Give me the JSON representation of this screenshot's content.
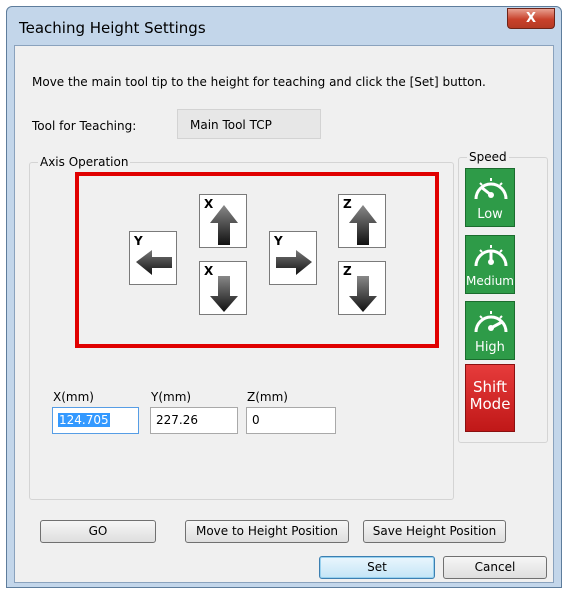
{
  "window": {
    "title": "Teaching Height Settings",
    "close_symbol": "X"
  },
  "instruction": "Move the main tool tip to the height for teaching and click the [Set] button.",
  "tool": {
    "label": "Tool for Teaching:",
    "value": "Main Tool TCP"
  },
  "axis_group": {
    "label": "Axis Operation",
    "jog_buttons": [
      {
        "axis": "Y",
        "direction": "minus",
        "icon": "arrow-left-icon"
      },
      {
        "axis": "X",
        "direction": "plus",
        "icon": "arrow-up-icon"
      },
      {
        "axis": "X",
        "direction": "minus",
        "icon": "arrow-down-icon"
      },
      {
        "axis": "Y",
        "direction": "plus",
        "icon": "arrow-right-icon"
      },
      {
        "axis": "Z",
        "direction": "plus",
        "icon": "arrow-up-icon"
      },
      {
        "axis": "Z",
        "direction": "minus",
        "icon": "arrow-down-icon"
      }
    ]
  },
  "speed_group": {
    "label": "Speed",
    "buttons": [
      {
        "label": "Low"
      },
      {
        "label": "Medium"
      },
      {
        "label": "High"
      }
    ],
    "shift_mode": {
      "line1": "Shift",
      "line2": "Mode"
    }
  },
  "coords": {
    "x": {
      "label": "X(mm)",
      "value": "124.705"
    },
    "y": {
      "label": "Y(mm)",
      "value": "227.26"
    },
    "z": {
      "label": "Z(mm)",
      "value": "0"
    }
  },
  "buttons": {
    "go": "GO",
    "move_to_height": "Move to Height Position",
    "save_height": "Save Height Position",
    "set": "Set",
    "cancel": "Cancel"
  },
  "colors": {
    "highlight": "#e00000",
    "speed_green": "#2e9b48",
    "shift_red": "#d42020",
    "selection": "#3399ff"
  }
}
